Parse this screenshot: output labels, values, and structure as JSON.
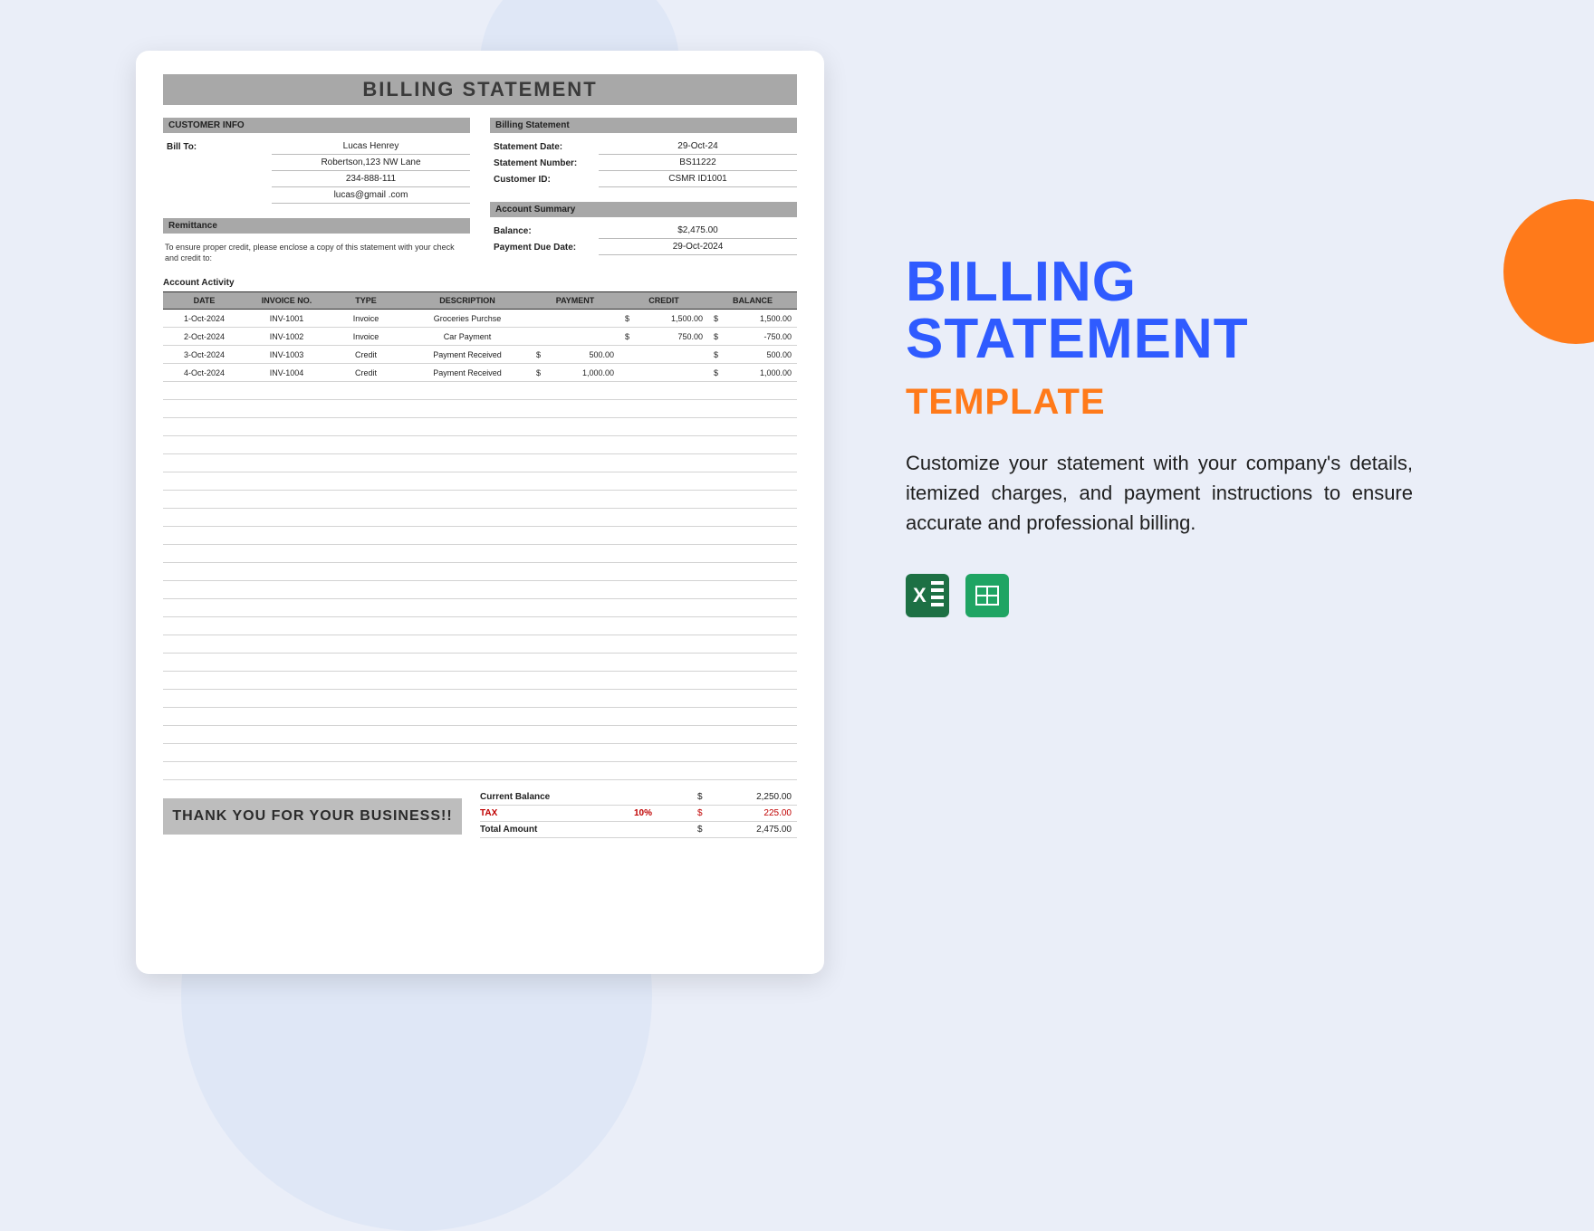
{
  "panel": {
    "title_l1": "BILLING",
    "title_l2": "STATEMENT",
    "subtitle": "TEMPLATE",
    "description": "Customize your statement with your company's details, itemized charges, and payment instructions to ensure accurate and professional billing."
  },
  "doc": {
    "title": "BILLING STATEMENT",
    "customer_info_head": "CUSTOMER INFO",
    "bill_to_label": "Bill To:",
    "bill_to_name": "Lucas Henrey",
    "bill_to_addr": "Robertson,123 NW Lane",
    "bill_to_phone": "234-888-111",
    "bill_to_email": "lucas@gmail .com",
    "remittance_head": "Remittance",
    "remittance_text": "To ensure proper credit, please enclose a copy of this statement with your check and credit to:",
    "stmt_head": "Billing Statement",
    "stmt_date_label": "Statement Date:",
    "stmt_date_value": "29-Oct-24",
    "stmt_num_label": "Statement Number:",
    "stmt_num_value": "BS11222",
    "cust_id_label": "Customer ID:",
    "cust_id_value": "CSMR ID1001",
    "acct_summary_head": "Account Summary",
    "balance_label": "Balance:",
    "balance_value": "$2,475.00",
    "due_label": "Payment Due Date:",
    "due_value": "29-Oct-2024",
    "activity_label": "Account Activity",
    "cols": {
      "date": "DATE",
      "inv": "INVOICE NO.",
      "type": "TYPE",
      "desc": "DESCRIPTION",
      "pay": "PAYMENT",
      "credit": "CREDIT",
      "bal": "BALANCE"
    },
    "rows": [
      {
        "date": "1-Oct-2024",
        "inv": "INV-1001",
        "type": "Invoice",
        "desc": "Groceries Purchse",
        "pay": "",
        "credit": "1,500.00",
        "bal": "1,500.00",
        "cs": "$",
        "bs": "$"
      },
      {
        "date": "2-Oct-2024",
        "inv": "INV-1002",
        "type": "Invoice",
        "desc": "Car Payment",
        "pay": "",
        "credit": "750.00",
        "bal": "-750.00",
        "cs": "$",
        "bs": "$"
      },
      {
        "date": "3-Oct-2024",
        "inv": "INV-1003",
        "type": "Credit",
        "desc": "Payment Received",
        "pay": "500.00",
        "ps": "$",
        "credit": "",
        "bal": "500.00",
        "bs": "$"
      },
      {
        "date": "4-Oct-2024",
        "inv": "INV-1004",
        "type": "Credit",
        "desc": "Payment Received",
        "pay": "1,000.00",
        "ps": "$",
        "credit": "",
        "bal": "1,000.00",
        "bs": "$"
      }
    ],
    "blank_rows": 22,
    "totals": {
      "curbal_label": "Current Balance",
      "curbal_value": "2,250.00",
      "tax_label": "TAX",
      "tax_pct": "10%",
      "tax_value": "225.00",
      "total_label": "Total Amount",
      "total_value": "2,475.00",
      "sym": "$"
    },
    "thanks": "THANK YOU FOR YOUR BUSINESS!!"
  }
}
